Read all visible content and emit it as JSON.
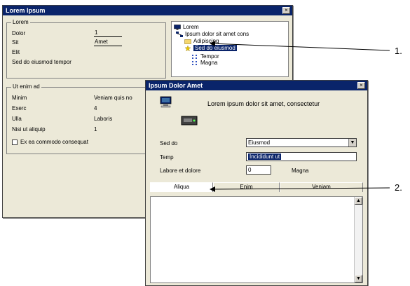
{
  "window1": {
    "title": "Lorem Ipsum",
    "group1": {
      "label": "Lorem",
      "rows": [
        {
          "label": "Dolor",
          "value": "1"
        },
        {
          "label": "Sit",
          "value": "Amet"
        },
        {
          "label": "Elit"
        },
        {
          "label": "Sed do eiusmod tempor"
        }
      ]
    },
    "group2": {
      "label": "Ut enim ad",
      "rows": [
        {
          "label": "Minim",
          "value": "Veniam quis no"
        },
        {
          "label": "Exerc",
          "value": "4"
        },
        {
          "label": "Ulla",
          "value": "Laboris"
        },
        {
          "label": "Nisi ut aliquip",
          "value": "1"
        }
      ],
      "checkbox_label": "Ex ea commodo consequat"
    },
    "tree": {
      "items": [
        {
          "label": "Lorem",
          "icon": "monitor-icon"
        },
        {
          "label": "Ipsum dolor sit amet cons",
          "icon": "network-icon"
        },
        {
          "label": "Adipiscing",
          "icon": "folder-icon"
        },
        {
          "label": "Sed do eiusmod",
          "icon": "star-icon"
        },
        {
          "label": "Tempor",
          "icon": "grid-icon"
        },
        {
          "label": "Magna",
          "icon": "grid-icon"
        }
      ]
    }
  },
  "window2": {
    "title": "Ipsum Dolor Amet",
    "description": "Lorem ipsum dolor sit amet, consectetur",
    "fields": [
      {
        "label": "Sed do",
        "type": "select",
        "value": "Eiusmod"
      },
      {
        "label": "Temp",
        "type": "text",
        "value": "Incididunt ut"
      },
      {
        "label": "Labore et dolore",
        "type": "text",
        "value": "0",
        "suffix": "Magna"
      }
    ],
    "tabs": [
      "Aliqua",
      "Enim",
      "Veniam"
    ]
  },
  "callouts": [
    "1.",
    "2."
  ]
}
